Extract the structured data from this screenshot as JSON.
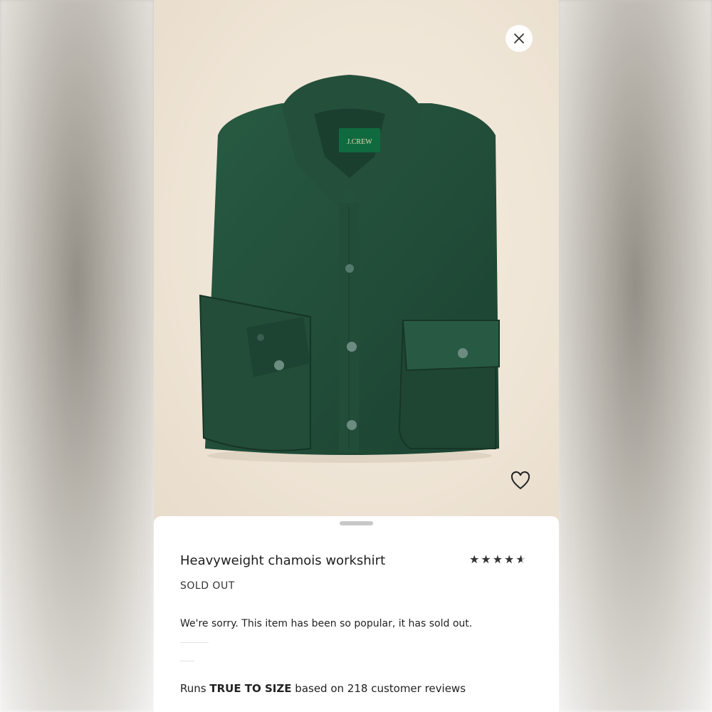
{
  "product": {
    "brand_label": "J.CREW",
    "title": "Heavyweight chamois workshirt",
    "rating": 4.5,
    "rating_max": 5,
    "status": "SOLD OUT",
    "message": "We're sorry. This item has been so popular, it has sold out.",
    "fit": {
      "prefix": "Runs",
      "emphasis": "TRUE TO SIZE",
      "suffix": "based on 218 customer reviews"
    }
  },
  "icons": {
    "close": "close-icon",
    "favorite": "heart-icon",
    "star": "star-icon"
  },
  "colors": {
    "shirt": "#1f4a34",
    "label": "#0f6b3f",
    "sheet": "#ffffff",
    "photo_bg": "#efe5d6"
  }
}
